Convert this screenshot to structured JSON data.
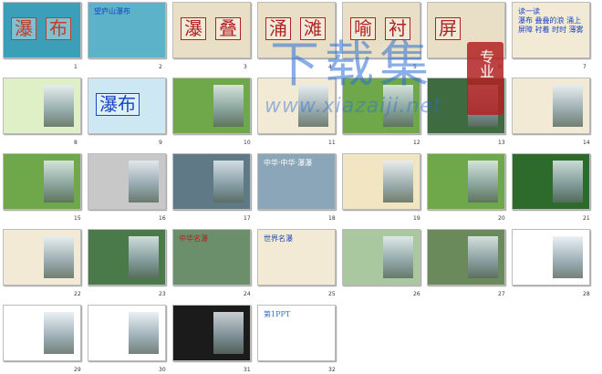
{
  "slides": [
    {
      "n": "1",
      "bg": "#3b9fb9",
      "texts": [
        "瀑",
        "布"
      ],
      "accent": "#c43c2c"
    },
    {
      "n": "2",
      "bg": "#5bb2c9",
      "texts": [
        "望庐山瀑布"
      ],
      "accent": "#1b46c4"
    },
    {
      "n": "3",
      "bg": "#e9dfc6",
      "texts": [
        "瀑",
        "叠"
      ],
      "accent": "#b22222"
    },
    {
      "n": "4",
      "bg": "#e9dfc6",
      "texts": [
        "涌",
        "滩"
      ],
      "accent": "#b22222"
    },
    {
      "n": "5",
      "bg": "#e9dfc6",
      "texts": [
        "喻",
        "衬"
      ],
      "accent": "#b22222"
    },
    {
      "n": "6",
      "bg": "#e9dfc6",
      "texts": [
        "屏"
      ],
      "accent": "#b22222"
    },
    {
      "n": "7",
      "bg": "#f2ead4",
      "texts": [
        "读一读",
        "瀑布 叠叠的浪 涌上",
        "屏障 衬着 时时 薄雾"
      ],
      "accent": "#1b46c4"
    },
    {
      "n": "8",
      "bg": "#dff0c6",
      "texts": [],
      "accent": "#1b46c4"
    },
    {
      "n": "9",
      "bg": "#cde8f2",
      "texts": [
        "瀑布"
      ],
      "accent": "#1b46c4"
    },
    {
      "n": "10",
      "bg": "#6ea84a",
      "texts": [],
      "accent": "#ffe86b"
    },
    {
      "n": "11",
      "bg": "#f2ead4",
      "texts": [],
      "accent": "#1b46c4"
    },
    {
      "n": "12",
      "bg": "#6ea84a",
      "texts": [],
      "accent": "#ffe86b"
    },
    {
      "n": "13",
      "bg": "#3f6b40",
      "texts": [],
      "accent": "#ffffff"
    },
    {
      "n": "14",
      "bg": "#f2ead4",
      "texts": [],
      "accent": "#1b46c4"
    },
    {
      "n": "15",
      "bg": "#6ea84a",
      "texts": [],
      "accent": "#ffe86b"
    },
    {
      "n": "16",
      "bg": "#c8c8c8",
      "texts": [],
      "accent": "#333333"
    },
    {
      "n": "17",
      "bg": "#5f7a86",
      "texts": [],
      "accent": "#ffffff"
    },
    {
      "n": "18",
      "bg": "#8aa6b8",
      "texts": [
        "中华·中华·瀑瀑"
      ],
      "accent": "#ffffff"
    },
    {
      "n": "19",
      "bg": "#f2e6c2",
      "texts": [],
      "accent": "#b22222"
    },
    {
      "n": "20",
      "bg": "#6ea84a",
      "texts": [],
      "accent": "#ffe86b"
    },
    {
      "n": "21",
      "bg": "#2d6b2d",
      "texts": [],
      "accent": "#ffffff"
    },
    {
      "n": "22",
      "bg": "#f2ead4",
      "texts": [],
      "accent": "#b22222"
    },
    {
      "n": "23",
      "bg": "#4a7a4a",
      "texts": [],
      "accent": "#b22222"
    },
    {
      "n": "24",
      "bg": "#6b8f6b",
      "texts": [
        "中华名瀑"
      ],
      "accent": "#b22222"
    },
    {
      "n": "25",
      "bg": "#f2ead4",
      "texts": [
        "世界名瀑"
      ],
      "accent": "#1b46c4"
    },
    {
      "n": "26",
      "bg": "#a9c8a0",
      "texts": [],
      "accent": "#ffffff"
    },
    {
      "n": "27",
      "bg": "#6b8a5b",
      "texts": [],
      "accent": "#ffffff"
    },
    {
      "n": "28",
      "bg": "#ffffff",
      "texts": [],
      "accent": "#1b46c4"
    },
    {
      "n": "29",
      "bg": "#ffffff",
      "texts": [],
      "accent": "#1b46c4"
    },
    {
      "n": "30",
      "bg": "#ffffff",
      "texts": [],
      "accent": "#1b46c4"
    },
    {
      "n": "31",
      "bg": "#1b1b1b",
      "texts": [],
      "accent": "#ffd24a"
    },
    {
      "n": "32",
      "bg": "#ffffff",
      "texts": [
        "第1PPT"
      ],
      "accent": "#3c6ec4"
    }
  ],
  "watermark": {
    "main": "下载集",
    "url": "www.xiazaiji.net",
    "badge": "专业",
    "color": "#2b6fd6",
    "badge_color": "#b22222"
  }
}
